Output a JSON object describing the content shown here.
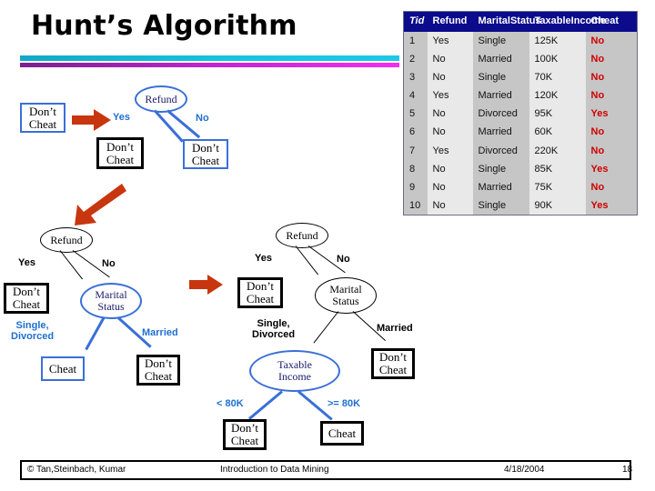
{
  "slide": {
    "title": "Hunt’s Algorithm",
    "accent_teal": "#15c4e0",
    "accent_purple": "#c024d0",
    "accent_blue": "#3a6fd8",
    "accent_red": "#c8360f",
    "header_blue": "#0b0b8c",
    "cheat_red": "#d00000"
  },
  "table": {
    "headers": [
      "Tid",
      "Refund",
      "Marital Status",
      "Taxable Income",
      "Cheat"
    ],
    "headers_wrapped": [
      [
        "Tid"
      ],
      [
        "Refund"
      ],
      [
        "Marital",
        "Status"
      ],
      [
        "Taxable",
        "Income"
      ],
      [
        "Cheat"
      ]
    ],
    "rows": [
      [
        "1",
        "Yes",
        "Single",
        "125K",
        "No"
      ],
      [
        "2",
        "No",
        "Married",
        "100K",
        "No"
      ],
      [
        "3",
        "No",
        "Single",
        "70K",
        "No"
      ],
      [
        "4",
        "Yes",
        "Married",
        "120K",
        "No"
      ],
      [
        "5",
        "No",
        "Divorced",
        "95K",
        "Yes"
      ],
      [
        "6",
        "No",
        "Married",
        "60K",
        "No"
      ],
      [
        "7",
        "Yes",
        "Divorced",
        "220K",
        "No"
      ],
      [
        "8",
        "No",
        "Single",
        "85K",
        "Yes"
      ],
      [
        "9",
        "No",
        "Married",
        "75K",
        "No"
      ],
      [
        "10",
        "No",
        "Single",
        "90K",
        "Yes"
      ]
    ]
  },
  "tree1": {
    "start_box": {
      "line1": "Don’t",
      "line2": "Cheat"
    },
    "root": {
      "line1": "Refund"
    },
    "edge_yes": "Yes",
    "edge_no": "No",
    "leaf_yes": {
      "line1": "Don’t",
      "line2": "Cheat"
    },
    "leaf_no": {
      "line1": "Don’t",
      "line2": "Cheat"
    }
  },
  "tree2": {
    "root": {
      "line1": "Refund"
    },
    "edge_yes": "Yes",
    "edge_no": "No",
    "leaf_yes": {
      "line1": "Don’t",
      "line2": "Cheat"
    },
    "marital": {
      "line1": "Marital",
      "line2": "Status"
    },
    "edge_single": {
      "line1": "Single,",
      "line2": "Divorced"
    },
    "edge_married": "Married",
    "leaf_cheat": {
      "line1": "Cheat"
    },
    "leaf_married": {
      "line1": "Don’t",
      "line2": "Cheat"
    }
  },
  "tree3": {
    "root": {
      "line1": "Refund"
    },
    "edge_yes": "Yes",
    "edge_no": "No",
    "leaf_yes": {
      "line1": "Don’t",
      "line2": "Cheat"
    },
    "marital": {
      "line1": "Marital",
      "line2": "Status"
    },
    "edge_single": {
      "line1": "Single,",
      "line2": "Divorced"
    },
    "edge_married": "Married",
    "leaf_married": {
      "line1": "Don’t",
      "line2": "Cheat"
    },
    "income": {
      "line1": "Taxable",
      "line2": "Income"
    },
    "edge_lt": "< 80K",
    "edge_ge": ">= 80K",
    "leaf_lt": {
      "line1": "Don’t",
      "line2": "Cheat"
    },
    "leaf_ge": {
      "line1": "Cheat"
    }
  },
  "footer": {
    "copyright": "© Tan,Steinbach, Kumar",
    "book": "Introduction to Data Mining",
    "date": "4/18/2004",
    "page": "18"
  }
}
